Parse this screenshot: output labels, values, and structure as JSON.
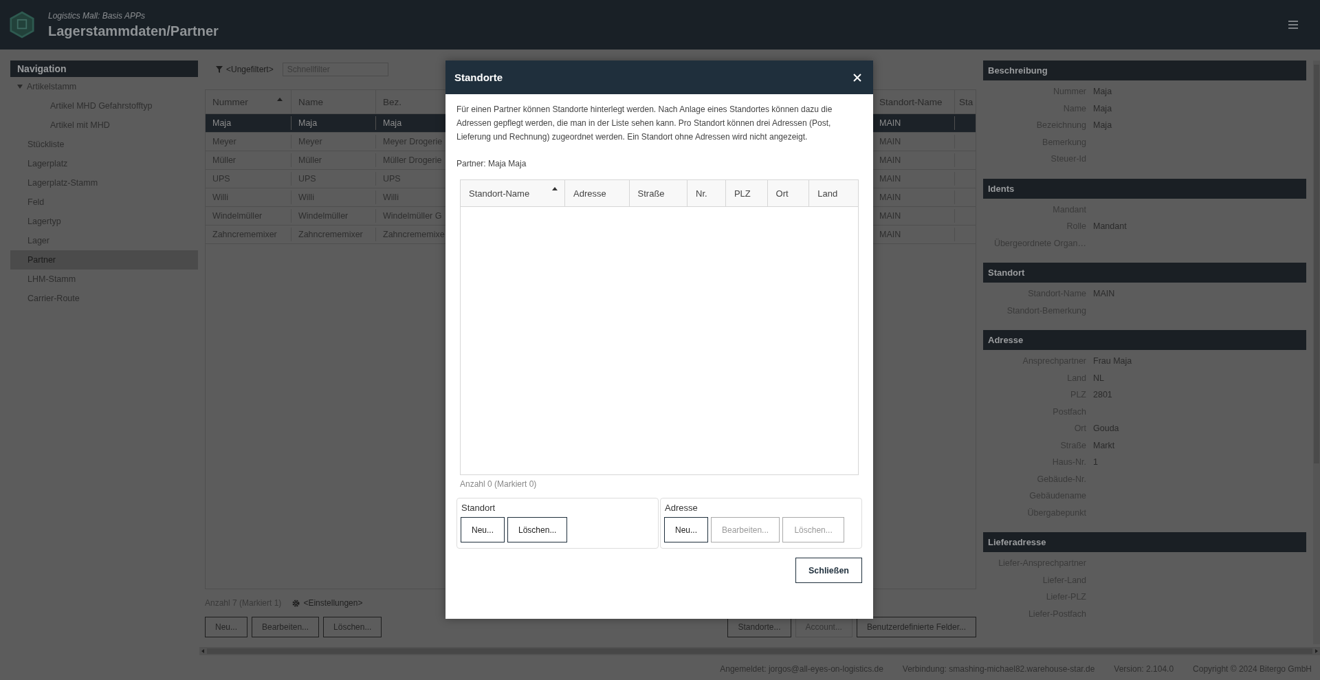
{
  "header": {
    "subtitle": "Logistics Mall: Basis APPs",
    "title": "Lagerstammdaten/Partner"
  },
  "navigation": {
    "title": "Navigation",
    "items": [
      {
        "label": "Artikelstamm",
        "selected": false,
        "expanded": true,
        "children": [
          {
            "label": "Artikel MHD Gefahrstofftyp",
            "selected": false
          },
          {
            "label": "Artikel mit MHD",
            "selected": false
          }
        ]
      },
      {
        "label": "Stückliste",
        "selected": false
      },
      {
        "label": "Lagerplatz",
        "selected": false
      },
      {
        "label": "Lagerplatz-Stamm",
        "selected": false
      },
      {
        "label": "Feld",
        "selected": false
      },
      {
        "label": "Lagertyp",
        "selected": false
      },
      {
        "label": "Lager",
        "selected": false
      },
      {
        "label": "Partner",
        "selected": true
      },
      {
        "label": "LHM-Stamm",
        "selected": false
      },
      {
        "label": "Carrier-Route",
        "selected": false
      }
    ]
  },
  "main": {
    "filter_label": "<Ungefiltert>",
    "quick_filter": {
      "placeholder": "Schnellfilter"
    },
    "table": {
      "columns": [
        {
          "label": "Nummer",
          "sorted": true
        },
        {
          "label": "Name",
          "sorted": false
        },
        {
          "label": "Bez.",
          "sorted": false
        },
        {
          "label": "Standort-Name",
          "sorted": false
        },
        {
          "label": "Sta",
          "sorted": false
        }
      ],
      "rows": [
        {
          "cells": [
            "Maja",
            "Maja",
            "Maja",
            "MAIN"
          ],
          "selected": true
        },
        {
          "cells": [
            "Meyer",
            "Meyer",
            "Meyer Drogerie",
            "MAIN"
          ],
          "selected": false
        },
        {
          "cells": [
            "Müller",
            "Müller",
            "Müller Drogerie",
            "MAIN"
          ],
          "selected": false
        },
        {
          "cells": [
            "UPS",
            "UPS",
            "UPS",
            "MAIN"
          ],
          "selected": false
        },
        {
          "cells": [
            "Willi",
            "Willi",
            "Willi",
            "MAIN"
          ],
          "selected": false
        },
        {
          "cells": [
            "Windelmüller",
            "Windelmüller",
            "Windelmüller G",
            "MAIN"
          ],
          "selected": false
        },
        {
          "cells": [
            "Zahncrememixer",
            "Zahncrememixer",
            "Zahncrememixe",
            "MAIN"
          ],
          "selected": false
        }
      ]
    },
    "count": "Anzahl 7 (Markiert 1)",
    "settings": "<Einstellungen>",
    "buttons": [
      {
        "label": "Neu...",
        "disabled": false
      },
      {
        "label": "Bearbeiten...",
        "disabled": false
      },
      {
        "label": "Löschen...",
        "disabled": false
      }
    ],
    "right_buttons": [
      {
        "label": "Standorte...",
        "disabled": false
      },
      {
        "label": "Account...",
        "disabled": true
      },
      {
        "label": "Benutzerdefinierte Felder...",
        "disabled": false
      }
    ]
  },
  "details": {
    "sections": [
      {
        "title": "Beschreibung",
        "fields": [
          {
            "label": "Nummer",
            "value": "Maja"
          },
          {
            "label": "Name",
            "value": "Maja"
          },
          {
            "label": "Bezeichnung",
            "value": "Maja"
          },
          {
            "label": "Bemerkung"
          },
          {
            "label": "Steuer-Id"
          }
        ]
      },
      {
        "title": "Idents",
        "fields": [
          {
            "label": "Mandant"
          },
          {
            "label": "Rolle",
            "value": "Mandant"
          },
          {
            "label": "Übergeordnete Organ…"
          }
        ]
      },
      {
        "title": "Standort",
        "fields": [
          {
            "label": "Standort-Name",
            "value": "MAIN"
          },
          {
            "label": "Standort-Bemerkung"
          }
        ]
      },
      {
        "title": "Adresse",
        "fields": [
          {
            "label": "Ansprechpartner",
            "value": "Frau Maja"
          },
          {
            "label": "Land",
            "value": "NL"
          },
          {
            "label": "PLZ",
            "value": "2801"
          },
          {
            "label": "Postfach"
          },
          {
            "label": "Ort",
            "value": "Gouda"
          },
          {
            "label": "Straße",
            "value": "Markt"
          },
          {
            "label": "Haus-Nr.",
            "value": "1"
          },
          {
            "label": "Gebäude-Nr."
          },
          {
            "label": "Gebäudename"
          },
          {
            "label": "Übergabepunkt"
          }
        ]
      },
      {
        "title": "Lieferadresse",
        "fields": [
          {
            "label": "Liefer-Ansprechpartner"
          },
          {
            "label": "Liefer-Land"
          },
          {
            "label": "Liefer-PLZ"
          },
          {
            "label": "Liefer-Postfach"
          }
        ]
      }
    ]
  },
  "dialog": {
    "title": "Standorte",
    "description": "Für einen Partner können Standorte hinterlegt werden. Nach Anlage eines Standortes können dazu die Adressen gepflegt werden, die man in der Liste sehen kann. Pro Standort können drei Adressen (Post, Lieferung und Rechnung) zugeordnet werden. Ein Standort ohne Adressen wird nicht angezeigt.",
    "partner": "Partner: Maja Maja",
    "table": {
      "columns": [
        {
          "label": "Standort-Name",
          "sorted": true
        },
        {
          "label": "Adresse",
          "sorted": false
        },
        {
          "label": "Straße",
          "sorted": false
        },
        {
          "label": "Nr.",
          "sorted": false
        },
        {
          "label": "PLZ",
          "sorted": false
        },
        {
          "label": "Ort",
          "sorted": false
        },
        {
          "label": "Land",
          "sorted": false
        }
      ]
    },
    "count": "Anzahl 0 (Markiert 0)",
    "groups": [
      {
        "title": "Standort",
        "buttons": [
          {
            "label": "Neu...",
            "disabled": false
          },
          {
            "label": "Löschen...",
            "disabled": false
          }
        ]
      },
      {
        "title": "Adresse",
        "buttons": [
          {
            "label": "Neu...",
            "disabled": false
          },
          {
            "label": "Bearbeiten...",
            "disabled": true
          },
          {
            "label": "Löschen...",
            "disabled": true
          }
        ]
      }
    ],
    "close_button": "Schließen"
  },
  "status_bar": [
    "Angemeldet: jorgos@all-eyes-on-logistics.de",
    "Verbindung: smashing-michael82.warehouse-star.de",
    "Version: 2.104.0",
    "Copyright © 2024 Bitergo GmbH"
  ]
}
